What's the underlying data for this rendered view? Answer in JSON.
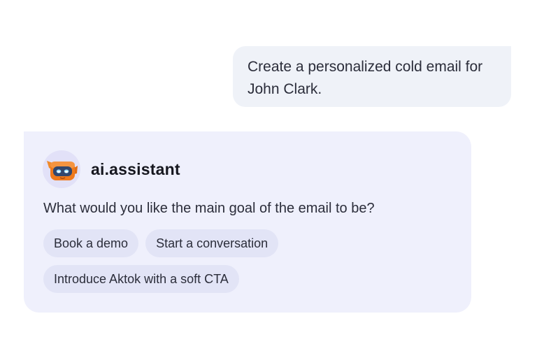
{
  "user_message": {
    "text": "Create a personalized cold email for John Clark."
  },
  "assistant": {
    "name": "ai.assistant",
    "avatar_icon": "robot-icon",
    "question": "What would you like the main goal of the email to be?",
    "options": [
      {
        "label": "Book a demo"
      },
      {
        "label": "Start a conversation"
      },
      {
        "label": "Introduce Aktok with a soft CTA"
      }
    ]
  },
  "colors": {
    "user_bubble_bg": "#eff2f8",
    "assistant_card_bg": "#eff0fc",
    "chip_bg": "#e2e4f6",
    "robot_orange": "#f07a1c",
    "robot_visor": "#33476d"
  }
}
